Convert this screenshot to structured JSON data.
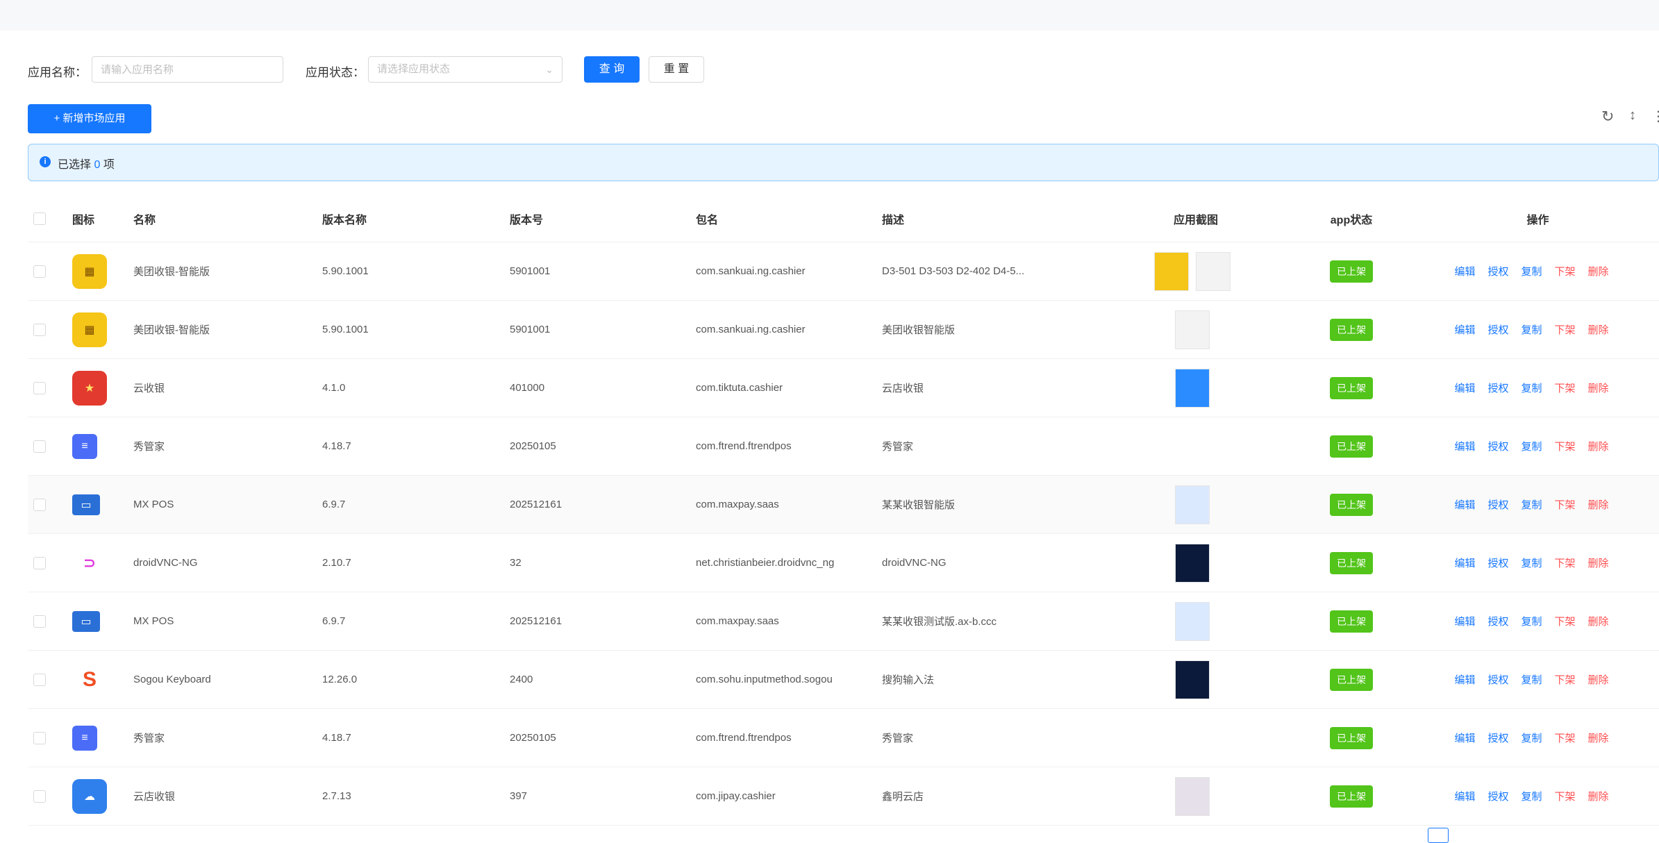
{
  "search": {
    "name_label": "应用名称：",
    "name_placeholder": "请输入应用名称",
    "status_label": "应用状态：",
    "status_placeholder": "请选择应用状态",
    "query_label": "查 询",
    "reset_label": "重 置"
  },
  "toolbar": {
    "add_label": "+ 新增市场应用"
  },
  "alert": {
    "prefix": "已选择",
    "count": "0",
    "suffix": "项"
  },
  "table": {
    "headers": [
      "图标",
      "名称",
      "版本名称",
      "版本号",
      "包名",
      "描述",
      "应用截图",
      "app状态",
      "操作"
    ],
    "action_labels": [
      "编辑",
      "授权",
      "复制",
      "下架",
      "删除"
    ],
    "rows": [
      {
        "icon": "yellow-square-icon",
        "name": "美团收银-智能版",
        "version_name": "5.90.1001",
        "version_code": "5901001",
        "package": "com.sankuai.ng.cashier",
        "desc": "D3-501 D3-503 D2-402 D4-5...",
        "status": "已上架"
      },
      {
        "icon": "yellow-square-icon",
        "name": "美团收银-智能版",
        "version_name": "5.90.1001",
        "version_code": "5901001",
        "package": "com.sankuai.ng.cashier",
        "desc": "美团收银智能版",
        "status": "已上架"
      },
      {
        "icon": "red-square-icon",
        "name": "云收银",
        "version_name": "4.1.0",
        "version_code": "401000",
        "package": "com.tiktuta.cashier",
        "desc": "云店收银",
        "status": "已上架"
      },
      {
        "icon": "blue-pos-icon",
        "name": "秀管家",
        "version_name": "4.18.7",
        "version_code": "20250105",
        "package": "com.ftrend.ftrendpos",
        "desc": "秀管家",
        "status": "已上架"
      },
      {
        "icon": "mx-pos-icon",
        "name": "MX POS",
        "version_name": "6.9.7",
        "version_code": "202512161",
        "package": "com.maxpay.saas",
        "desc": "某某收银智能版",
        "status": "已上架"
      },
      {
        "icon": "droidvnc-icon",
        "name": "droidVNC-NG",
        "version_name": "2.10.7",
        "version_code": "32",
        "package": "net.christianbeier.droidvnc_ng",
        "desc": "droidVNC-NG",
        "status": "已上架"
      },
      {
        "icon": "mx-pos-icon",
        "name": "MX POS",
        "version_name": "6.9.7",
        "version_code": "202512161",
        "package": "com.maxpay.saas",
        "desc": "某某收银测试版.ax-b.ccc",
        "status": "已上架"
      },
      {
        "icon": "sogou-icon",
        "name": "Sogou Keyboard",
        "version_name": "12.26.0",
        "version_code": "2400",
        "package": "com.sohu.inputmethod.sogou",
        "desc": "搜狗输入法",
        "status": "已上架"
      },
      {
        "icon": "blue-pos-icon",
        "name": "秀管家",
        "version_name": "4.18.7",
        "version_code": "20250105",
        "package": "com.ftrend.ftrendpos",
        "desc": "秀管家",
        "status": "已上架"
      },
      {
        "icon": "cloud-cashier-icon",
        "name": "云店收银",
        "version_name": "2.7.13",
        "version_code": "397",
        "package": "com.jipay.cashier",
        "desc": "鑫明云店",
        "status": "已上架"
      }
    ]
  },
  "colors": {
    "primary": "#1677ff",
    "success": "#52c41a",
    "danger": "#ff4d4f",
    "alert_bg": "#e6f4ff"
  }
}
